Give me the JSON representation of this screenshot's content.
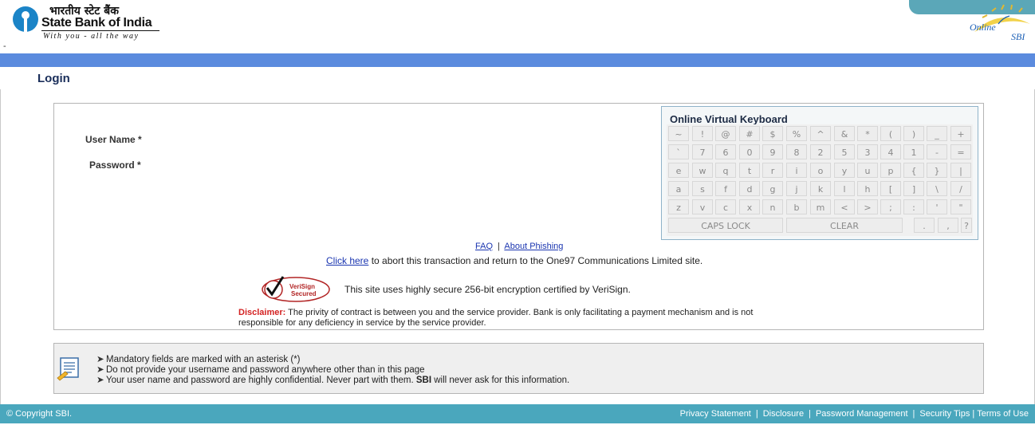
{
  "header": {
    "hindi_name": "भारतीय स्टेट बैंक",
    "bank_name": "State Bank of India",
    "tagline": "With you - all the way",
    "dash": "-",
    "online_logo_text": "Online",
    "online_logo_sub": "SBI"
  },
  "login": {
    "title": "Login",
    "username_label": "User Name *",
    "password_label": "Password *"
  },
  "keyboard": {
    "title": "Online Virtual Keyboard",
    "rows": [
      [
        "~",
        "!",
        "@",
        "#",
        "$",
        "%",
        "^",
        "&",
        "*",
        "(",
        ")",
        "_",
        "+"
      ],
      [
        "`",
        "7",
        "6",
        "0",
        "9",
        "8",
        "2",
        "5",
        "3",
        "4",
        "1",
        "-",
        "="
      ],
      [
        "e",
        "w",
        "q",
        "t",
        "r",
        "i",
        "o",
        "y",
        "u",
        "p",
        "{",
        "}",
        "|"
      ],
      [
        "a",
        "s",
        "f",
        "d",
        "g",
        "j",
        "k",
        "l",
        "h",
        "[",
        "]",
        "\\",
        "/"
      ],
      [
        "z",
        "v",
        "c",
        "x",
        "n",
        "b",
        "m",
        "<",
        ">",
        ";",
        ":",
        "'",
        "\""
      ]
    ],
    "caps_lock": "CAPS LOCK",
    "clear": "CLEAR",
    "last_keys": [
      ".",
      ",",
      "?"
    ]
  },
  "links": {
    "faq": "FAQ",
    "sep": "|",
    "about_phishing": "About Phishing",
    "click_here": "Click here",
    "abort_text": " to abort this transaction and return to the One97 Communications Limited site."
  },
  "verisign": {
    "badge_line1": "VeriSign",
    "badge_line2": "Secured",
    "text": "This site uses highly secure 256-bit encryption certified by VeriSign."
  },
  "disclaimer": {
    "label": "Disclaimer:",
    "text": " The privity of contract is between you and the service provider. Bank is only facilitating a payment mechanism and is not responsible for any deficiency in service by the service provider."
  },
  "info": {
    "bullet": "➤",
    "line1": "Mandatory fields are marked with an asterisk (*)",
    "line2": "Do not provide your username and password anywhere other than in this page",
    "line3_pre": "Your user name and password are highly confidential. Never part with them. ",
    "line3_bold": "SBI",
    "line3_post": " will never ask for this information."
  },
  "footer": {
    "copyright": "© Copyright SBI.",
    "links": [
      "Privacy Statement",
      "Disclosure",
      "Password Management",
      "Security Tips",
      "Terms of Use"
    ],
    "sep": "|"
  },
  "colors": {
    "blue_bar": "#5b8bde",
    "footer": "#4aa7bd",
    "link": "#1a35b0",
    "disclaimer_label": "#d32222"
  }
}
